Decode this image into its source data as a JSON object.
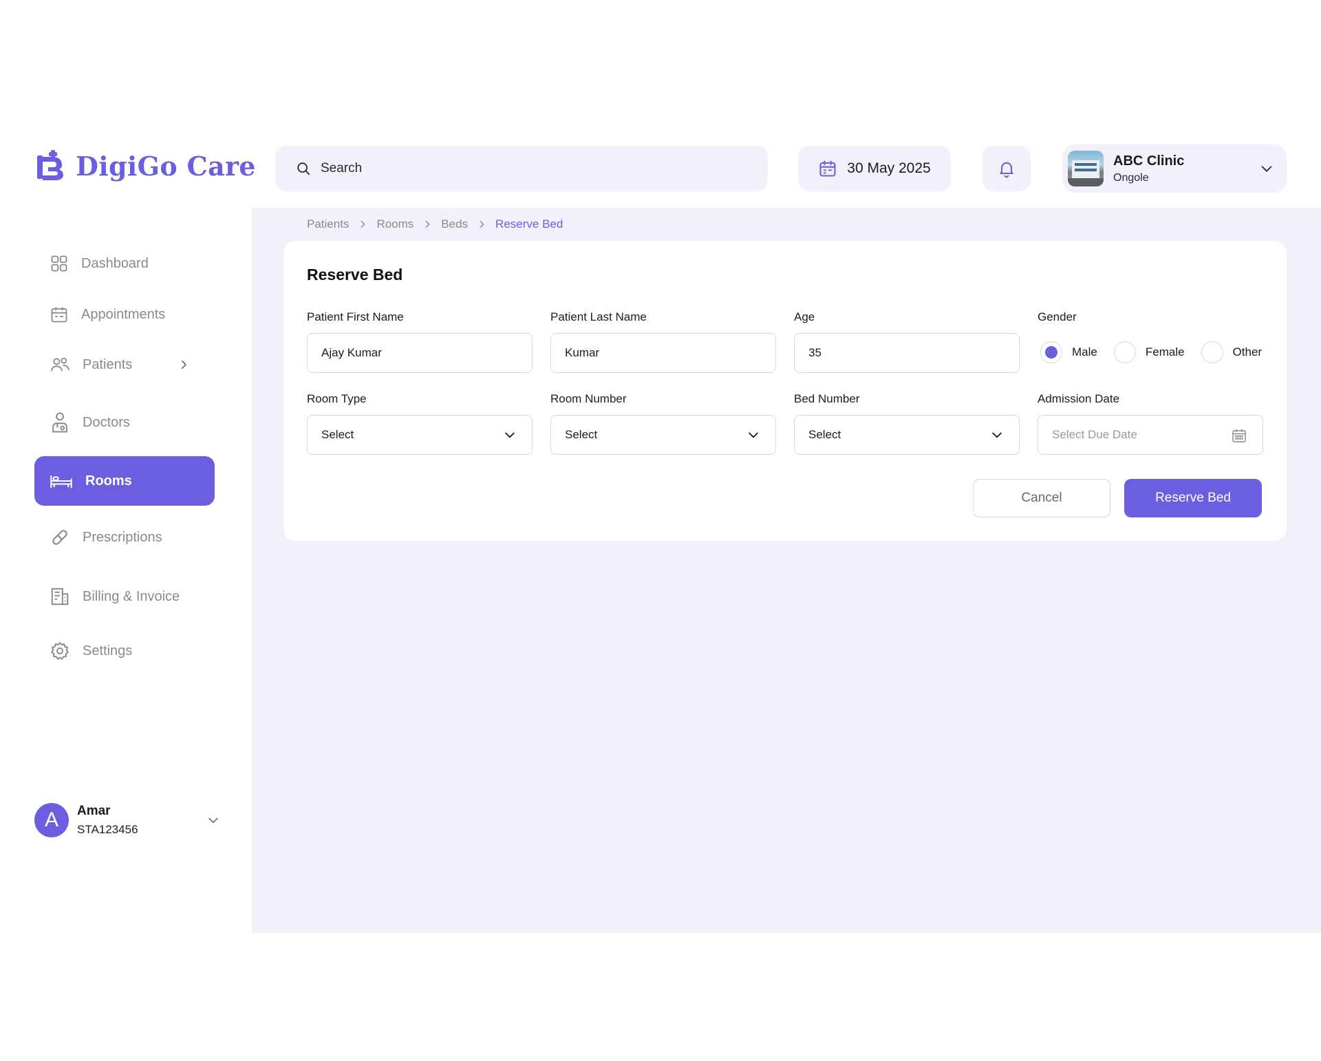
{
  "brand": {
    "name": "DigiGo Care",
    "color": "#6b5ee0"
  },
  "header": {
    "search_placeholder": "Search",
    "date": "30 May 2025",
    "clinic": {
      "name": "ABC Clinic",
      "location": "Ongole"
    }
  },
  "sidebar": {
    "items": [
      {
        "label": "Dashboard",
        "icon": "grid-icon"
      },
      {
        "label": "Appointments",
        "icon": "calendar-icon"
      },
      {
        "label": "Patients",
        "icon": "users-icon"
      },
      {
        "label": "Doctors",
        "icon": "doctor-icon"
      },
      {
        "label": "Rooms",
        "icon": "bed-icon",
        "active": true
      },
      {
        "label": "Prescriptions",
        "icon": "pill-icon"
      },
      {
        "label": "Billing & Invoice",
        "icon": "invoice-icon"
      },
      {
        "label": "Settings",
        "icon": "gear-icon"
      }
    ],
    "user": {
      "initial": "A",
      "name": "Amar",
      "id": "STA123456"
    }
  },
  "breadcrumb": [
    "Patients",
    "Rooms",
    "Beds",
    "Reserve Bed"
  ],
  "form": {
    "title": "Reserve Bed",
    "first_name": {
      "label": "Patient First Name",
      "value": "Ajay Kumar"
    },
    "last_name": {
      "label": "Patient Last Name",
      "value": "Kumar"
    },
    "age": {
      "label": "Age",
      "value": "35"
    },
    "gender": {
      "label": "Gender",
      "options": [
        "Male",
        "Female",
        "Other"
      ],
      "selected": "Male"
    },
    "room_type": {
      "label": "Room Type",
      "value": "Select"
    },
    "room_number": {
      "label": "Room Number",
      "value": "Select"
    },
    "bed_number": {
      "label": "Bed Number",
      "value": "Select"
    },
    "admission_date": {
      "label": "Admission Date",
      "placeholder": "Select Due Date"
    },
    "cancel_label": "Cancel",
    "submit_label": "Reserve Bed"
  }
}
